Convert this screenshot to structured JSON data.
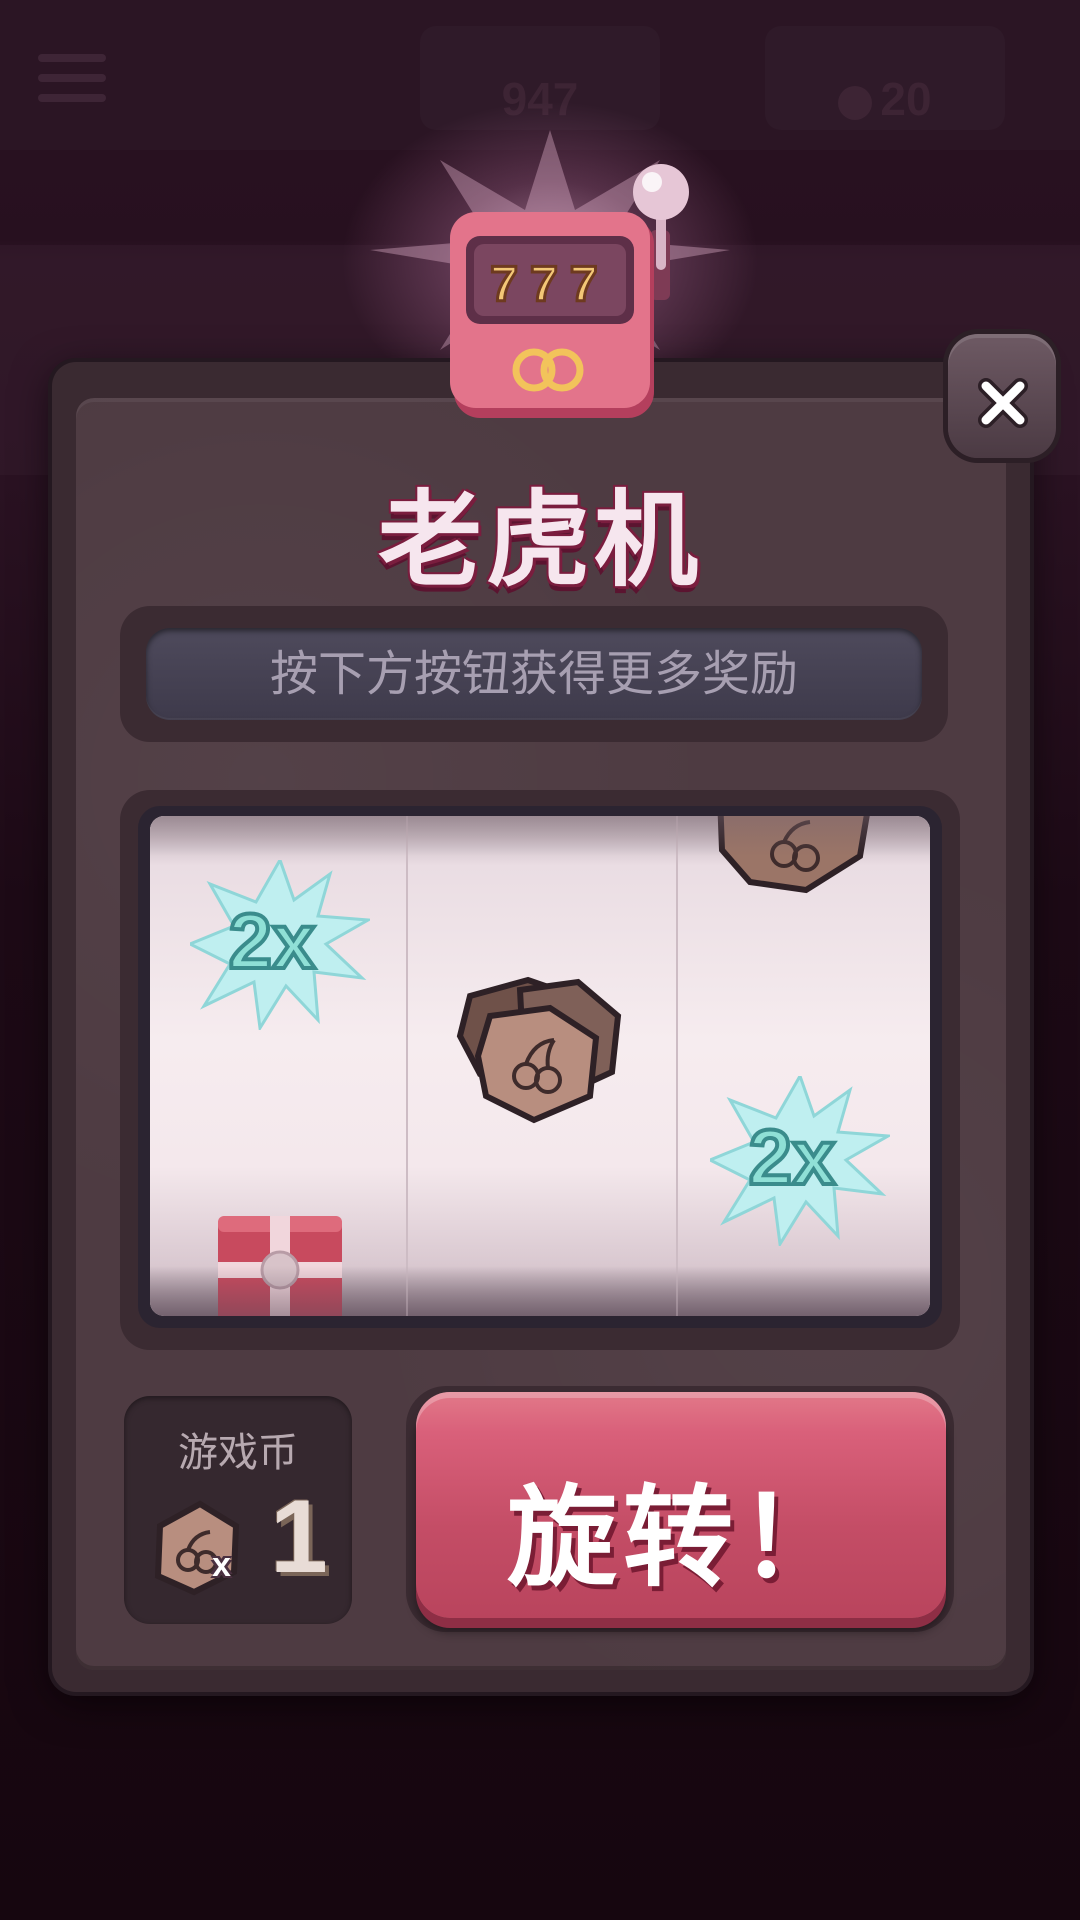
{
  "background": {
    "score_label": "947",
    "coin_balance": "20"
  },
  "dialog": {
    "slot_icon_digits": "777",
    "title": "老虎机",
    "hint": "按下方按钮获得更多奖励",
    "reels": [
      {
        "symbols": [
          "2x",
          "gift-box"
        ]
      },
      {
        "symbols": [
          "fruit-coin-stack"
        ]
      },
      {
        "symbols": [
          "fruit-coin",
          "2x"
        ]
      }
    ],
    "multiplier_text": "2x",
    "coins_label": "游戏币",
    "coins_multiplier": "x",
    "coins_count": "1",
    "spin_label": "旋转！"
  },
  "colors": {
    "dialog_bg": "#4e3b42",
    "spin_button": "#c44d66",
    "title_outline": "#7a1d3e",
    "multiplier_fill": "#8fe0d6"
  }
}
